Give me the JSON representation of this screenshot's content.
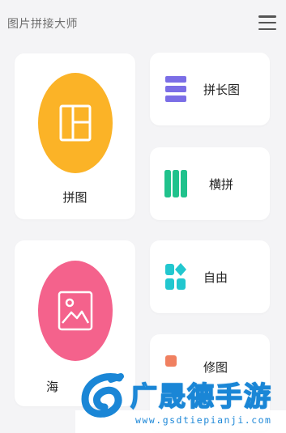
{
  "header": {
    "title": "图片拼接大师",
    "menu_icon": "menu-icon"
  },
  "cards": {
    "pintu": {
      "label": "拼图",
      "color": "#fbb327",
      "icon": "collage-layout-icon"
    },
    "haibao": {
      "label": "海",
      "color": "#f4628c",
      "icon": "image-icon"
    },
    "pinchangtu": {
      "label": "拼长图",
      "color": "#7b6ee6",
      "icon": "stacked-rows-icon"
    },
    "hengpin": {
      "label": "横拼",
      "color": "#20c28c",
      "icon": "columns-icon"
    },
    "ziyou": {
      "label": "自由",
      "color": "#22c7cf",
      "icon": "shapes-icon"
    },
    "partial": {
      "label": "修图",
      "color": "#f08060",
      "icon": "edit-icon"
    }
  },
  "watermark": {
    "name": "广晟德手游",
    "url": "www.gsdtiepianji.com"
  }
}
